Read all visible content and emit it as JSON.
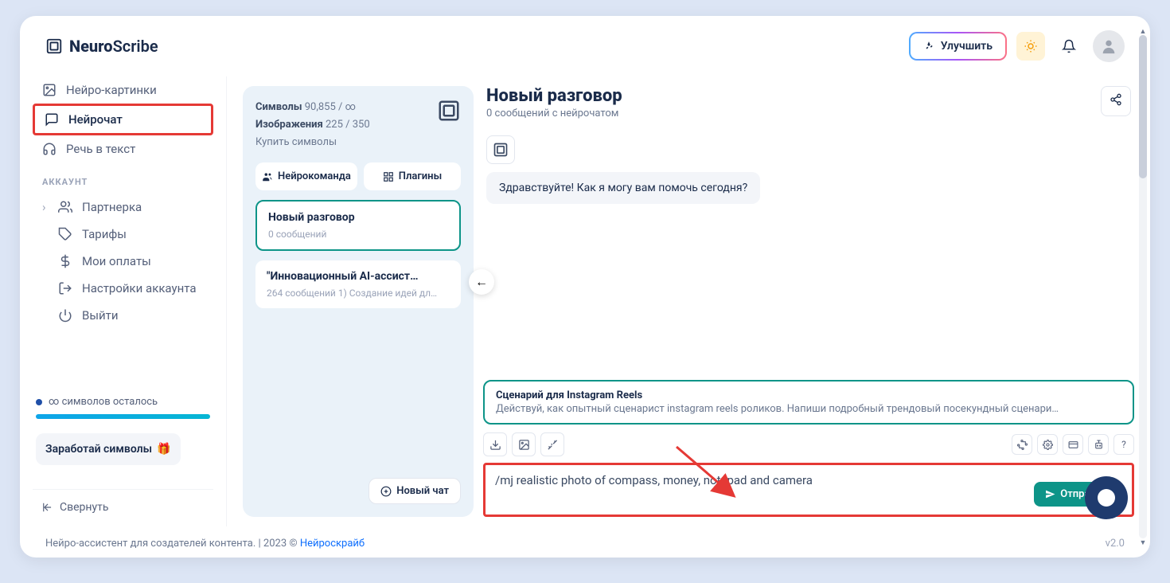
{
  "brand": {
    "name_bold": "Neuro",
    "name_light": "Scribe"
  },
  "topbar": {
    "upgrade_label": "Улучшить"
  },
  "sidebar": {
    "items": [
      {
        "label": "Нейро-картинки"
      },
      {
        "label": "Нейрочат"
      },
      {
        "label": "Речь в текст"
      }
    ],
    "account_section_label": "АККАУНТ",
    "account_items": [
      {
        "label": "Партнерка"
      },
      {
        "label": "Тарифы"
      },
      {
        "label": "Мои оплаты"
      },
      {
        "label": "Настройки аккаунта"
      },
      {
        "label": "Выйти"
      }
    ],
    "usage_text": "∞ символов осталось",
    "earn_label": "Заработай символы",
    "collapse_label": "Свернуть"
  },
  "stats": {
    "symbols_label": "Символы",
    "symbols_value": "90,855 / ∞",
    "images_label": "Изображения",
    "images_value": "225 / 350",
    "buy_label": "Купить символы"
  },
  "pills": {
    "team": "Нейрокоманда",
    "plugins": "Плагины"
  },
  "conversations": [
    {
      "title": "Новый разговор",
      "sub": "0 сообщений"
    },
    {
      "title": "\"Инновационный AI-ассист…",
      "sub": "264 сообщений 1) Создание идей дл…"
    }
  ],
  "new_chat_label": "Новый чат",
  "chat_header": {
    "title": "Новый разговор",
    "sub": "0 сообщений с нейрочатом"
  },
  "greeting": "Здравствуйте! Как я могу вам помочь сегодня?",
  "template": {
    "title": "Сценарий для Instagram Reels",
    "desc": "Действуй, как опытный сценарист instagram reels роликов. Напиши подробный трендовый посекундный сценари…"
  },
  "input_value": "/mj realistic photo of compass, money, notepad and camera",
  "send_label": "Отправить",
  "footer": {
    "text_prefix": "Нейро-ассистент для создателей контента.  | 2023 © ",
    "link": "Нейроскрайб",
    "version": "v2.0"
  }
}
